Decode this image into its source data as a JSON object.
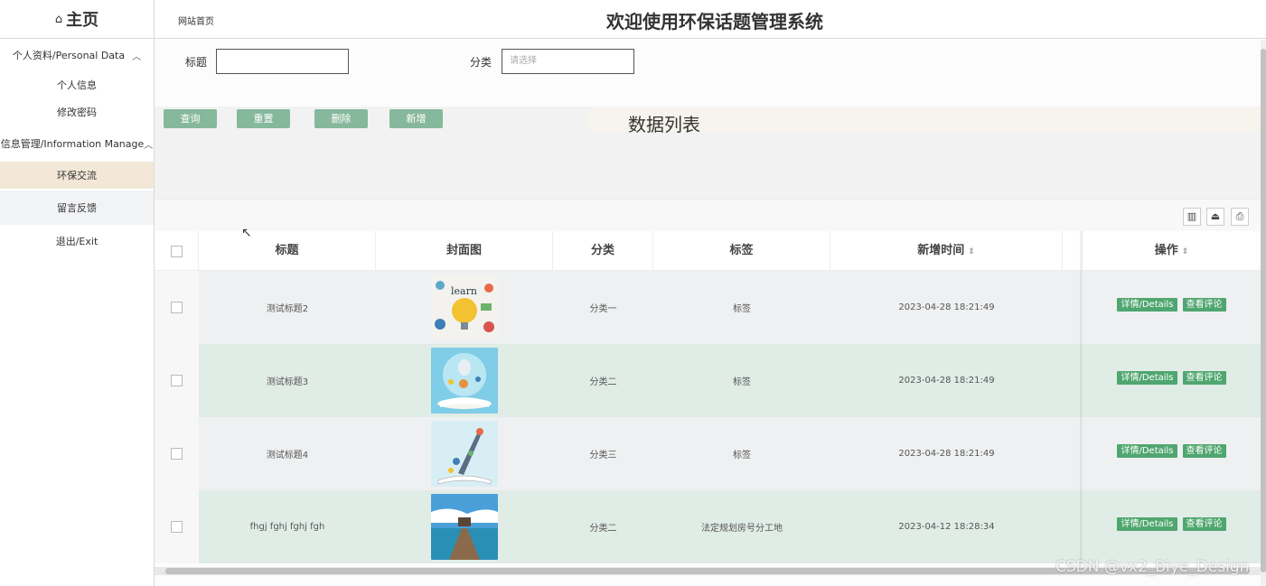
{
  "sidebar": {
    "brand": "主页",
    "groups": [
      {
        "label": "个人资料/Personal Data",
        "items": [
          "个人信息",
          "修改密码"
        ]
      },
      {
        "label": "信息管理/Information Manage",
        "items": [
          "环保交流",
          "留言反馈"
        ]
      }
    ],
    "exit": "退出/Exit"
  },
  "header": {
    "breadcrumb": "网站首页",
    "title": "欢迎使用环保话题管理系统"
  },
  "filters": {
    "title_label": "标题",
    "title_value": "",
    "category_label": "分类",
    "category_placeholder": "请选择"
  },
  "buttons": {
    "query": "查询",
    "reset": "重置",
    "delete": "删除",
    "add": "新增"
  },
  "list_title": "数据列表",
  "table": {
    "columns": [
      "标题",
      "封面图",
      "分类",
      "标签",
      "新增时间",
      "操作"
    ],
    "rows": [
      {
        "title": "测试标题2",
        "category": "分类一",
        "tag": "标签",
        "time": "2023-04-28 18:21:49",
        "detail": "详情/Details",
        "comment": "查看评论"
      },
      {
        "title": "测试标题3",
        "category": "分类二",
        "tag": "标签",
        "time": "2023-04-28 18:21:49",
        "detail": "详情/Details",
        "comment": "查看评论"
      },
      {
        "title": "测试标题4",
        "category": "分类三",
        "tag": "标签",
        "time": "2023-04-28 18:21:49",
        "detail": "详情/Details",
        "comment": "查看评论"
      },
      {
        "title": "fhgj fghj fghj fgh",
        "category": "分类二",
        "tag": "法定规划房号分工地",
        "time": "2023-04-12 18:28:34",
        "detail": "详情/Details",
        "comment": "查看评论"
      }
    ]
  },
  "watermark": "CSDN @vx2_Biye_Design",
  "colors": {
    "accent_button": "#86b89b",
    "op_button": "#4fa66f",
    "active_menu": "#f3e8d8",
    "row_alt": "#e0ece6"
  }
}
